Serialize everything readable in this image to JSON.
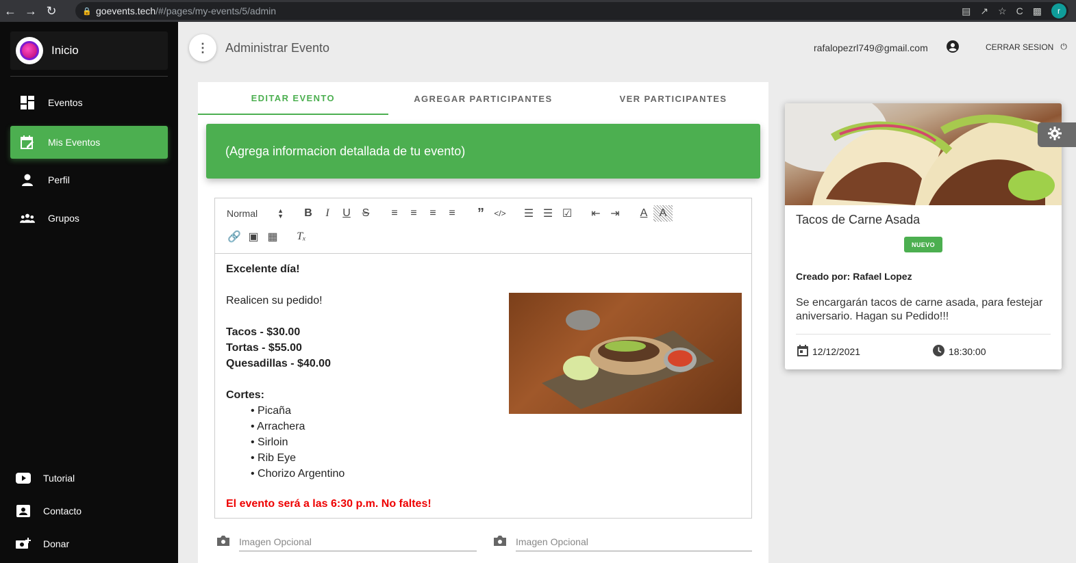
{
  "browser": {
    "url_host": "goevents.tech",
    "url_path": "/#/pages/my-events/5/admin",
    "profile_initial": "r"
  },
  "sidebar": {
    "brand": "Inicio",
    "items": [
      {
        "label": "Eventos",
        "icon": "dashboard-icon",
        "active": false
      },
      {
        "label": "Mis Eventos",
        "icon": "calendar-edit-icon",
        "active": true
      },
      {
        "label": "Perfil",
        "icon": "person-icon",
        "active": false
      },
      {
        "label": "Grupos",
        "icon": "group-icon",
        "active": false
      }
    ],
    "bottom_items": [
      {
        "label": "Tutorial",
        "icon": "youtube-icon"
      },
      {
        "label": "Contacto",
        "icon": "contact-card-icon"
      },
      {
        "label": "Donar",
        "icon": "donate-icon"
      }
    ]
  },
  "header": {
    "title": "Administrar Evento",
    "email": "rafalopezrl749@gmail.com",
    "logout": "CERRAR SESION"
  },
  "tabs": [
    "EDITAR EVENTO",
    "AGREGAR PARTICIPANTES",
    "VER PARTICIPANTES"
  ],
  "banner": "(Agrega informacion detallada de tu evento)",
  "editor": {
    "format_select": "Normal",
    "greeting": "Excelente día!",
    "intro": "Realicen su pedido!",
    "prices": [
      "Tacos - $30.00",
      "Tortas - $55.00",
      "Quesadillas - $40.00"
    ],
    "cortes_title": "Cortes:",
    "cortes": [
      "Picaña",
      "Arrachera",
      "Sirloin",
      "Rib Eye",
      "Chorizo Argentino"
    ],
    "footer_note": "El evento será a las 6:30 p.m. No faltes!"
  },
  "image_fields": [
    "Imagen Opcional",
    "Imagen Opcional"
  ],
  "event_card": {
    "title": "Tacos de Carne Asada",
    "badge": "NUEVO",
    "creator": "Creado por: Rafael Lopez",
    "description": "Se encargarán tacos de carne asada, para festejar aniversario. Hagan su Pedido!!!",
    "date": "12/12/2021",
    "time": "18:30:00"
  },
  "colors": {
    "accent": "#4caf50",
    "sidebar_bg": "#0c0c0c",
    "alert_red": "#ee0000"
  }
}
